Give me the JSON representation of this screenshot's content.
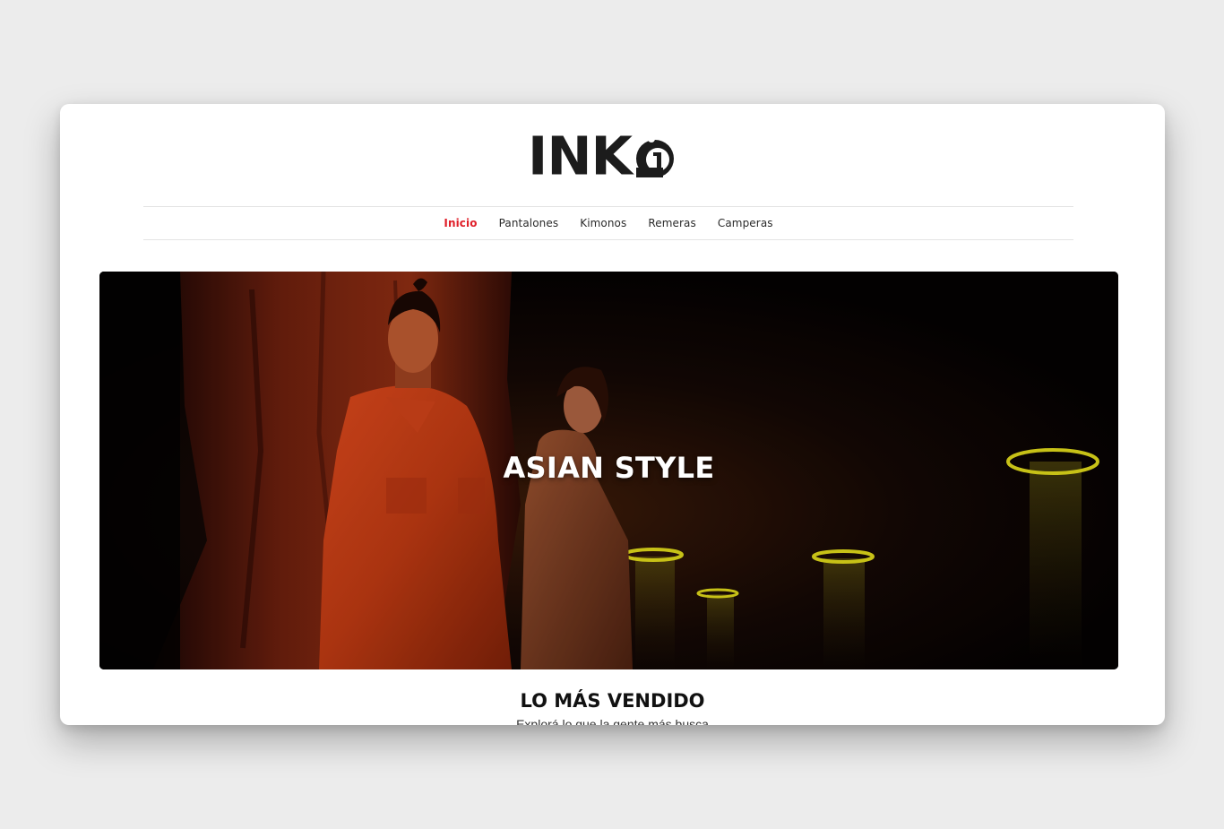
{
  "brand": {
    "logo_text": "INK",
    "logo_color": "#1c1c1c"
  },
  "nav": {
    "items": [
      {
        "label": "Inicio",
        "active": true
      },
      {
        "label": "Pantalones",
        "active": false
      },
      {
        "label": "Kimonos",
        "active": false
      },
      {
        "label": "Remeras",
        "active": false
      },
      {
        "label": "Camperas",
        "active": false
      }
    ],
    "active_color": "#e0202a"
  },
  "hero": {
    "title": "ASIAN STYLE"
  },
  "bestsellers": {
    "title": "LO MÁS VENDIDO",
    "subtitle": "Explorá lo que la gente más busca"
  },
  "colors": {
    "page_background": "#ececec",
    "card_background": "#ffffff",
    "accent": "#e0202a",
    "neon": "#d8d21a"
  }
}
